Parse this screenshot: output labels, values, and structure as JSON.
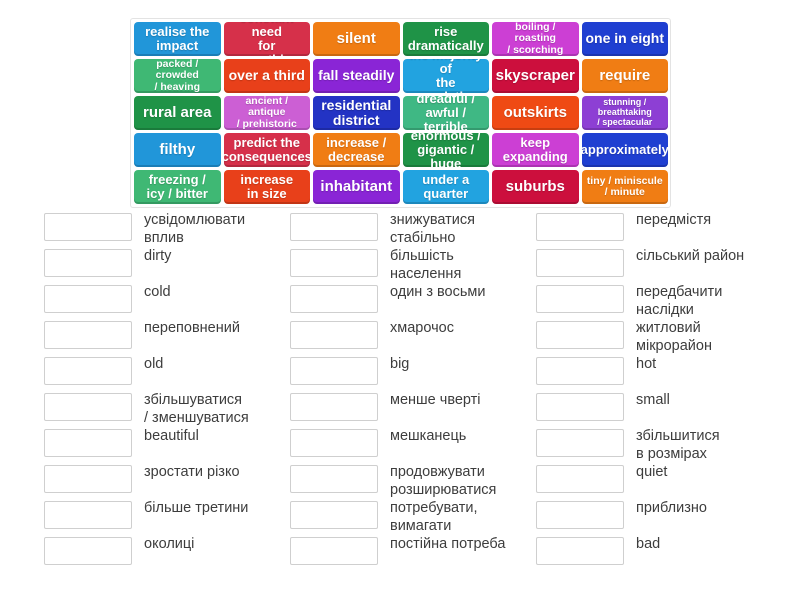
{
  "activity": {
    "type": "match-up-word-tiles",
    "tile_bank": {
      "rows": [
        [
          {
            "label": "realise the\nimpact",
            "color": "#2196d9",
            "size": "fs-13"
          },
          {
            "label": "constant need\nfor something",
            "color": "#d6304a",
            "size": "fs-13"
          },
          {
            "label": "silent",
            "color": "#f07d14",
            "size": "fs-15"
          },
          {
            "label": "rise\ndramatically",
            "color": "#1f9347",
            "size": "fs-13"
          },
          {
            "label": "boiling / roasting\n/ scorching",
            "color": "#cc3fd4",
            "size": "fs-11"
          },
          {
            "label": "one in eight",
            "color": "#1f3fd1",
            "size": "fs-14"
          }
        ],
        [
          {
            "label": "packed / crowded\n/ heaving",
            "color": "#3fb874",
            "size": "fs-11"
          },
          {
            "label": "over a third",
            "color": "#e8401a",
            "size": "fs-14"
          },
          {
            "label": "fall steadily",
            "color": "#8a25d6",
            "size": "fs-14"
          },
          {
            "label": "the majority of\nthe population",
            "color": "#22a3e0",
            "size": "fs-13"
          },
          {
            "label": "skyscraper",
            "color": "#cc0f3d",
            "size": "fs-15"
          },
          {
            "label": "require",
            "color": "#f07d14",
            "size": "fs-15"
          }
        ],
        [
          {
            "label": "rural area",
            "color": "#1f9347",
            "size": "fs-15"
          },
          {
            "label": "ancient / antique\n/ prehistoric",
            "color": "#cc5fd4",
            "size": "fs-11"
          },
          {
            "label": "residential\ndistrict",
            "color": "#2333c4",
            "size": "fs-14"
          },
          {
            "label": "dreadful /\nawful / terrible",
            "color": "#3fb884",
            "size": "fs-13"
          },
          {
            "label": "outskirts",
            "color": "#ef4a14",
            "size": "fs-15"
          },
          {
            "label": "stunning /\nbreathtaking\n/ spectacular",
            "color": "#8d3fd4",
            "size": "fs-9"
          }
        ],
        [
          {
            "label": "filthy",
            "color": "#2196d9",
            "size": "fs-15"
          },
          {
            "label": "predict the\nconsequences",
            "color": "#d6304a",
            "size": "fs-13"
          },
          {
            "label": "increase /\ndecrease",
            "color": "#f07d14",
            "size": "fs-13"
          },
          {
            "label": "enormous /\ngigantic / huge",
            "color": "#1f9347",
            "size": "fs-13"
          },
          {
            "label": "keep\nexpanding",
            "color": "#cc3fd4",
            "size": "fs-13"
          },
          {
            "label": "approximately",
            "color": "#1f3fd1",
            "size": "fs-13"
          }
        ],
        [
          {
            "label": "freezing /\nicy / bitter",
            "color": "#3fb874",
            "size": "fs-13"
          },
          {
            "label": "increase\nin size",
            "color": "#e8401a",
            "size": "fs-13"
          },
          {
            "label": "inhabitant",
            "color": "#8a25d6",
            "size": "fs-15"
          },
          {
            "label": "under a\nquarter",
            "color": "#22a3e0",
            "size": "fs-13"
          },
          {
            "label": "suburbs",
            "color": "#cc0f3d",
            "size": "fs-15"
          },
          {
            "label": "tiny / miniscule\n/ minute",
            "color": "#f07d14",
            "size": "fs-11"
          }
        ]
      ]
    },
    "answers": {
      "columns": [
        {
          "items": [
            {
              "label": "усвідомлювати\nвплив",
              "value": ""
            },
            {
              "label": "dirty",
              "value": ""
            },
            {
              "label": "cold",
              "value": ""
            },
            {
              "label": "переповнений",
              "value": ""
            },
            {
              "label": "old",
              "value": ""
            },
            {
              "label": "збільшуватися\n/ зменшуватися",
              "value": ""
            },
            {
              "label": "beautiful",
              "value": ""
            },
            {
              "label": "зростати різко",
              "value": ""
            },
            {
              "label": "більше третини",
              "value": ""
            },
            {
              "label": "околиці",
              "value": ""
            }
          ]
        },
        {
          "items": [
            {
              "label": "знижуватися\nстабільно",
              "value": ""
            },
            {
              "label": "більшість\nнаселення",
              "value": ""
            },
            {
              "label": "один з восьми",
              "value": ""
            },
            {
              "label": "хмарочос",
              "value": ""
            },
            {
              "label": "big",
              "value": ""
            },
            {
              "label": "менше чверті",
              "value": ""
            },
            {
              "label": "мешканець",
              "value": ""
            },
            {
              "label": "продовжувати\nрозширюватися",
              "value": ""
            },
            {
              "label": "потребувати,\nвимагати",
              "value": ""
            },
            {
              "label": "постійна потреба",
              "value": ""
            }
          ]
        },
        {
          "items": [
            {
              "label": "передмістя",
              "value": ""
            },
            {
              "label": "сільський район",
              "value": ""
            },
            {
              "label": "передбачити\nнаслідки",
              "value": ""
            },
            {
              "label": "житловий\nмікрорайон",
              "value": ""
            },
            {
              "label": "hot",
              "value": ""
            },
            {
              "label": "small",
              "value": ""
            },
            {
              "label": "збільшитися\nв розмірах",
              "value": ""
            },
            {
              "label": "quiet",
              "value": ""
            },
            {
              "label": "приблизно",
              "value": ""
            },
            {
              "label": "bad",
              "value": ""
            }
          ]
        }
      ]
    }
  }
}
